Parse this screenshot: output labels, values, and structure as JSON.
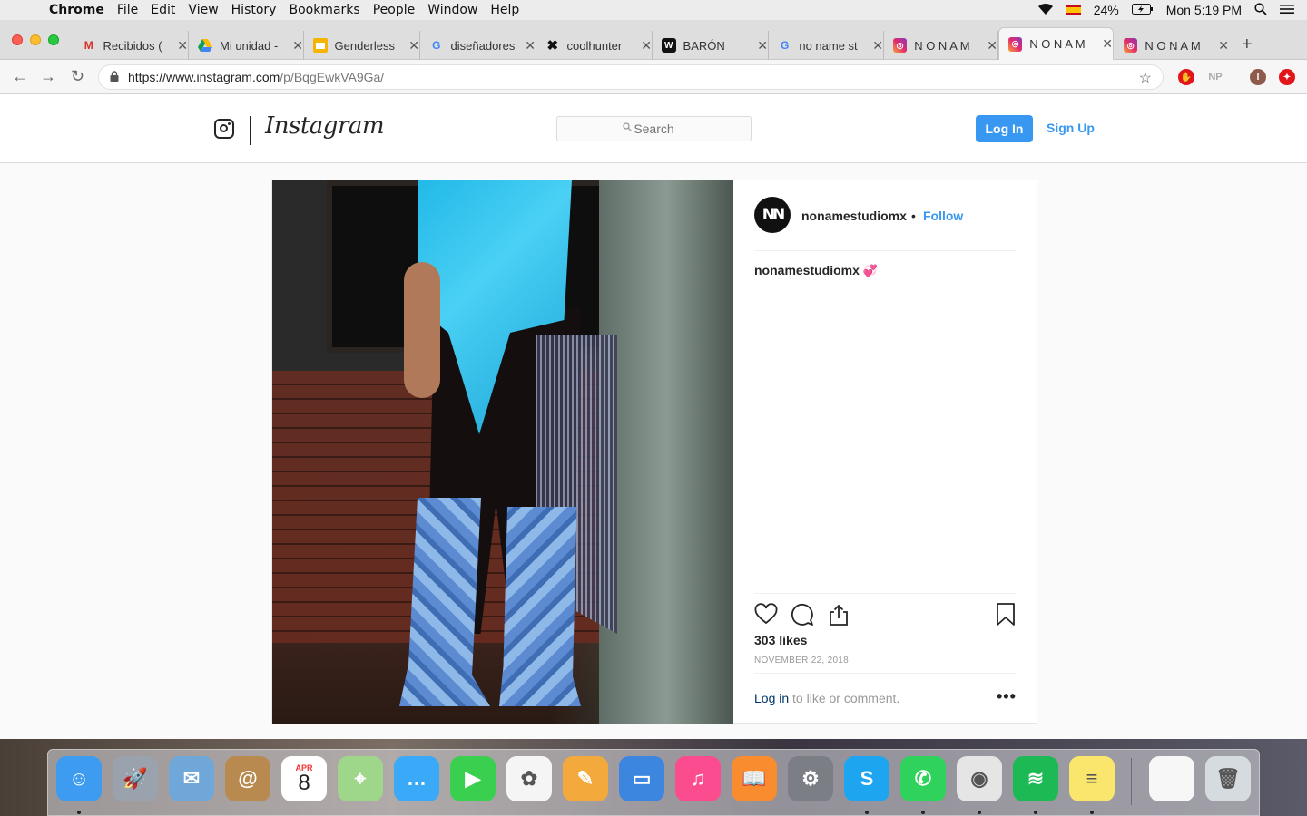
{
  "menubar": {
    "app": "Chrome",
    "items": [
      "File",
      "Edit",
      "View",
      "History",
      "Bookmarks",
      "People",
      "Window",
      "Help"
    ],
    "battery": "24%",
    "clock": "Mon 5:19 PM"
  },
  "tabs": [
    {
      "title": "Recibidos (",
      "favicon": "gmail-icon"
    },
    {
      "title": "Mi unidad -",
      "favicon": "google-drive-icon"
    },
    {
      "title": "Genderless",
      "favicon": "google-slides-icon"
    },
    {
      "title": "diseñadores",
      "favicon": "google-icon"
    },
    {
      "title": "coolhunter",
      "favicon": "x-icon"
    },
    {
      "title": "BARÓN",
      "favicon": "baron-icon"
    },
    {
      "title": "no name st",
      "favicon": "google-icon"
    },
    {
      "title": "N O N A M",
      "favicon": "instagram-icon"
    },
    {
      "title": "N O N A M",
      "favicon": "instagram-icon",
      "active": true
    },
    {
      "title": "N O N A M",
      "favicon": "instagram-icon"
    }
  ],
  "address": {
    "host": "https://www.instagram.com",
    "path": "/p/BqgEwkVA9Ga/"
  },
  "extensions": [
    "NP",
    "I"
  ],
  "instagram": {
    "wordmark": "Instagram",
    "search_placeholder": "Search",
    "login_label": "Log In",
    "signup_label": "Sign Up"
  },
  "post": {
    "username": "nonamestudiomx",
    "avatar_text": "NN",
    "dot": "•",
    "follow_label": "Follow",
    "caption_user": "nonamestudiomx",
    "caption_emoji": "💞",
    "likes": "303 likes",
    "date": "NOVEMBER 22, 2018",
    "login_link": "Log in",
    "comment_prompt": " to like or comment.",
    "more": "•••"
  },
  "dock": [
    {
      "name": "finder-icon",
      "color": "#3d9bf0"
    },
    {
      "name": "launchpad-icon",
      "color": "#9aa3ad"
    },
    {
      "name": "mail-icon",
      "color": "#6ea7d8"
    },
    {
      "name": "contacts-icon",
      "color": "#b88a4f"
    },
    {
      "name": "calendar-icon",
      "color": "#ffffff",
      "month": "APR",
      "day": "8"
    },
    {
      "name": "maps-icon",
      "color": "#9ed78a"
    },
    {
      "name": "messages-icon",
      "color": "#3aa9f7"
    },
    {
      "name": "facetime-icon",
      "color": "#3bcf50"
    },
    {
      "name": "photos-icon",
      "color": "#f5f5f5"
    },
    {
      "name": "pages-icon",
      "color": "#f3a93c"
    },
    {
      "name": "keynote-icon",
      "color": "#3d86e0"
    },
    {
      "name": "itunes-icon",
      "color": "#fb4c8f"
    },
    {
      "name": "ibooks-icon",
      "color": "#f88c2e"
    },
    {
      "name": "system-preferences-icon",
      "color": "#7b7f85"
    },
    {
      "name": "skype-icon",
      "color": "#1ea5f0"
    },
    {
      "name": "whatsapp-icon",
      "color": "#2fd25b"
    },
    {
      "name": "chrome-icon",
      "color": "#e5e5e5"
    },
    {
      "name": "spotify-icon",
      "color": "#1db954"
    },
    {
      "name": "notes-icon",
      "color": "#fbe66d"
    },
    {
      "name": "document-icon",
      "color": "#f7f7f7"
    },
    {
      "name": "trash-icon",
      "color": "#d6dbe0"
    }
  ]
}
